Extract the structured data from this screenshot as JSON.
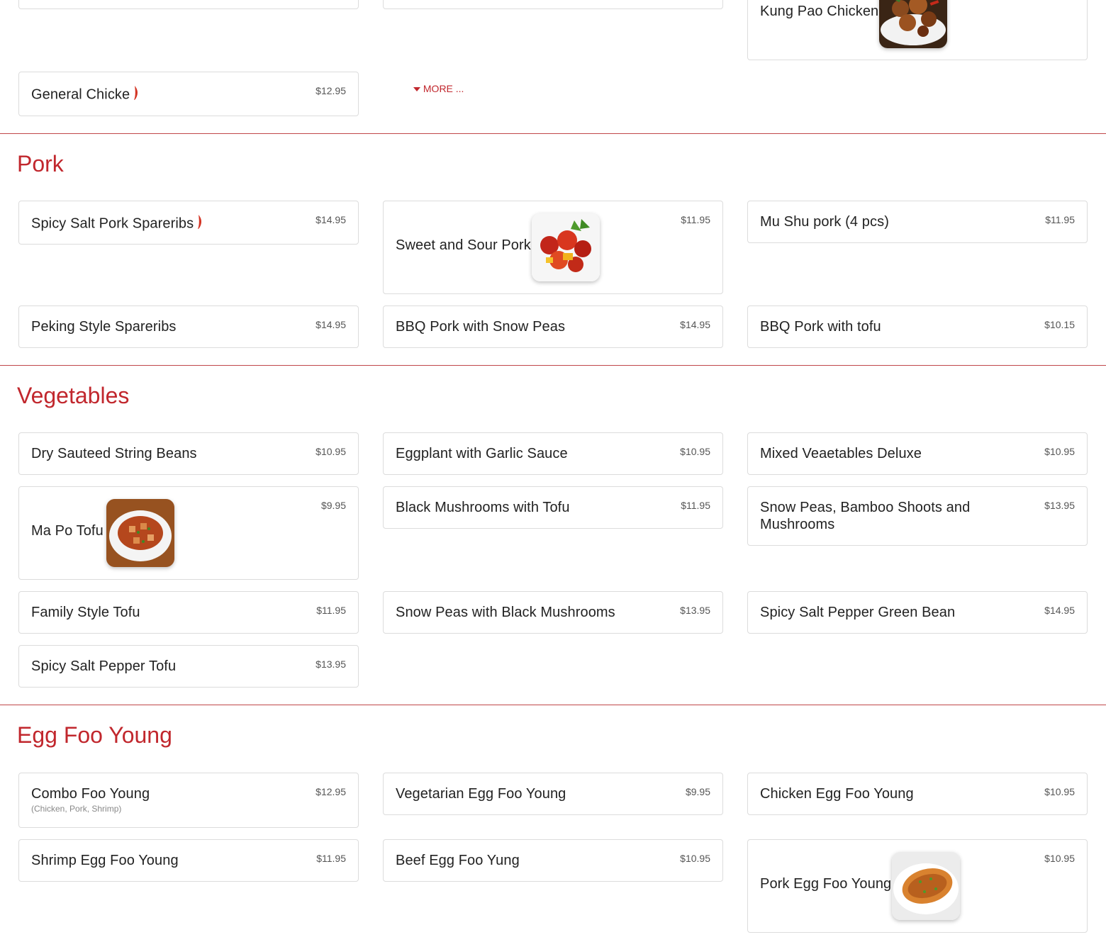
{
  "chicken": {
    "kung_pao": {
      "name": "Kung Pao Chicken"
    },
    "general": {
      "name": "General Chicke",
      "price": "$12.95"
    },
    "more_label": "MORE ..."
  },
  "pork": {
    "title": "Pork",
    "items": [
      {
        "name": "Spicy Salt Pork Spareribs",
        "price": "$14.95"
      },
      {
        "name": "Sweet and Sour Pork",
        "price": "$11.95"
      },
      {
        "name": "Mu Shu pork (4 pcs)",
        "price": "$11.95"
      },
      {
        "name": "Peking Style Spareribs",
        "price": "$14.95"
      },
      {
        "name": "BBQ Pork with Snow Peas",
        "price": "$14.95"
      },
      {
        "name": "BBQ Pork with tofu",
        "price": "$10.15"
      }
    ]
  },
  "vegetables": {
    "title": "Vegetables",
    "items": [
      {
        "name": "Dry Sauteed String Beans",
        "price": "$10.95"
      },
      {
        "name": "Eggplant with Garlic Sauce",
        "price": "$10.95"
      },
      {
        "name": "Mixed Veaetables Deluxe",
        "price": "$10.95"
      },
      {
        "name": "Ma Po Tofu",
        "price": "$9.95"
      },
      {
        "name": "Black Mushrooms with Tofu",
        "price": "$11.95"
      },
      {
        "name": "Snow Peas, Bamboo Shoots and Mushrooms",
        "price": "$13.95"
      },
      {
        "name": "Family Style Tofu",
        "price": "$11.95"
      },
      {
        "name": "Snow Peas with Black Mushrooms",
        "price": "$13.95"
      },
      {
        "name": "Spicy Salt Pepper Green Bean",
        "price": "$14.95"
      },
      {
        "name": "Spicy Salt Pepper Tofu",
        "price": "$13.95"
      }
    ]
  },
  "egg_foo_young": {
    "title": "Egg Foo Young",
    "items": [
      {
        "name": "Combo Foo Young",
        "price": "$12.95",
        "desc": "(Chicken, Pork, Shrimp)"
      },
      {
        "name": "Vegetarian Egg Foo Young",
        "price": "$9.95"
      },
      {
        "name": "Chicken Egg Foo Young",
        "price": "$10.95"
      },
      {
        "name": "Shrimp Egg Foo Young",
        "price": "$11.95"
      },
      {
        "name": "Beef Egg Foo Yung",
        "price": "$10.95"
      },
      {
        "name": "Pork Egg Foo Young",
        "price": "$10.95"
      }
    ]
  },
  "colors": {
    "accent": "#c1272d",
    "border": "#dcdcdc",
    "divider": "#c0474a"
  }
}
